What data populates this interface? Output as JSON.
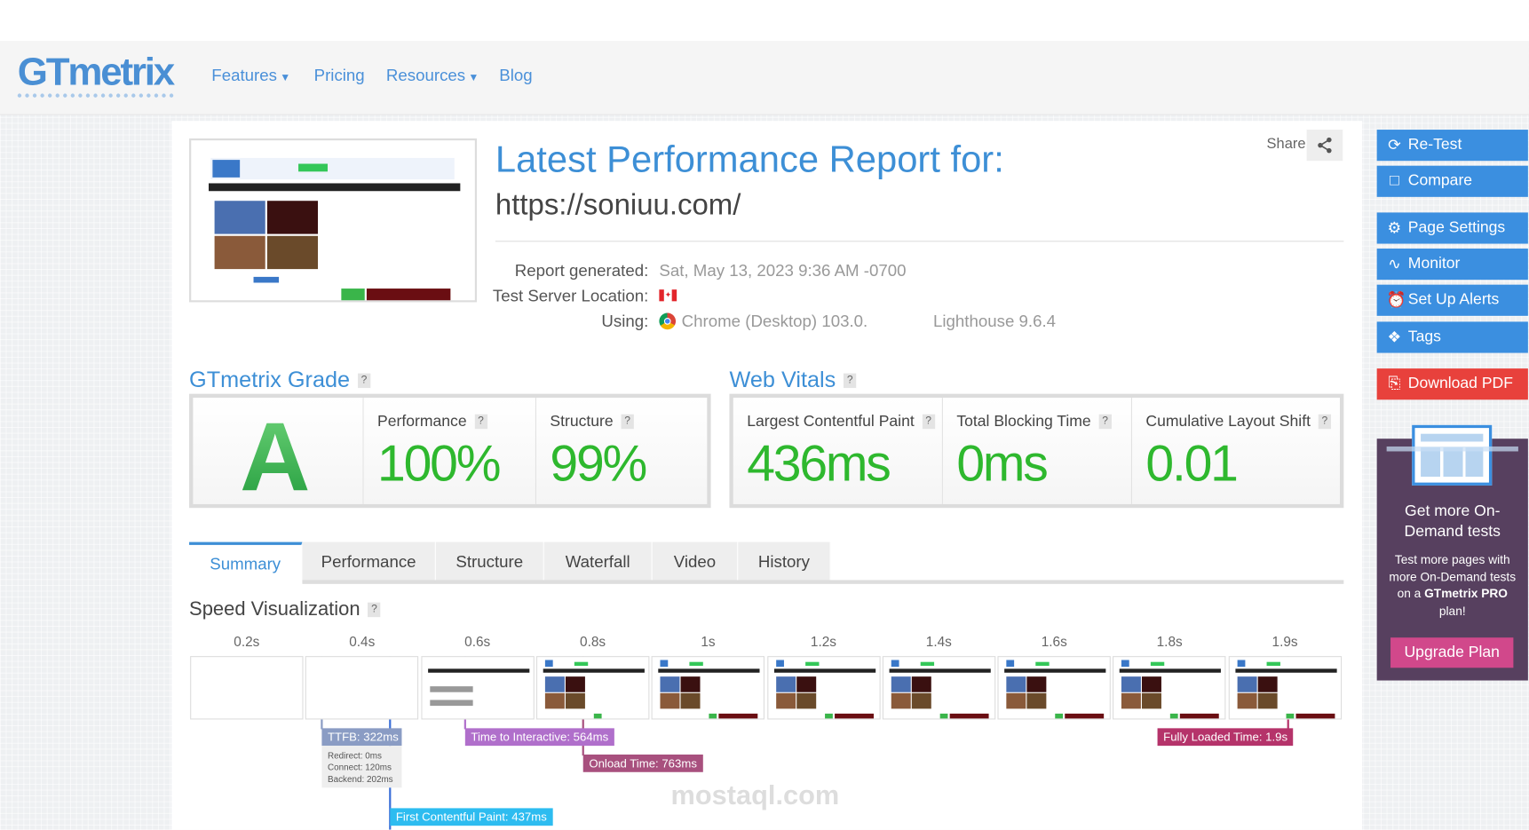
{
  "header": {
    "logo": "GTmetrix",
    "nav": [
      {
        "label": "Features",
        "dropdown": true
      },
      {
        "label": "Pricing",
        "dropdown": false
      },
      {
        "label": "Resources",
        "dropdown": true
      },
      {
        "label": "Blog",
        "dropdown": false
      }
    ]
  },
  "report": {
    "title": "Latest Performance Report for:",
    "url": "https://soniuu.com/",
    "share_label": "Share",
    "info": [
      {
        "label": "Report generated:",
        "value": "Sat, May 13, 2023 9:36 AM -0700"
      },
      {
        "label": "Test Server Location:",
        "value": ""
      },
      {
        "label": "Using:",
        "value": "Chrome (Desktop) 103.0.",
        "extra": "Lighthouse 9.6.4"
      }
    ]
  },
  "grade": {
    "heading": "GTmetrix Grade",
    "letter": "A",
    "metrics": [
      {
        "label": "Performance",
        "value": "100%"
      },
      {
        "label": "Structure",
        "value": "99%"
      }
    ]
  },
  "vitals": {
    "heading": "Web Vitals",
    "metrics": [
      {
        "label": "Largest Contentful Paint",
        "value": "436ms"
      },
      {
        "label": "Total Blocking Time",
        "value": "0ms"
      },
      {
        "label": "Cumulative Layout Shift",
        "value": "0.01"
      }
    ]
  },
  "tabs": [
    {
      "label": "Summary",
      "active": true
    },
    {
      "label": "Performance"
    },
    {
      "label": "Structure"
    },
    {
      "label": "Waterfall"
    },
    {
      "label": "Video"
    },
    {
      "label": "History"
    }
  ],
  "speed": {
    "heading": "Speed Visualization",
    "ticks": [
      "0.2s",
      "0.4s",
      "0.6s",
      "0.8s",
      "1s",
      "1.2s",
      "1.4s",
      "1.6s",
      "1.8s",
      "1.9s"
    ],
    "markers": {
      "ttfb": "TTFB: 322ms",
      "ttfb_details": [
        "Redirect: 0ms",
        "Connect: 120ms",
        "Backend: 202ms"
      ],
      "tti": "Time to Interactive: 564ms",
      "onload": "Onload Time: 763ms",
      "fcp": "First Contentful Paint: 437ms",
      "fully": "Fully Loaded Time: 1.9s"
    }
  },
  "sidebar": {
    "buttons": [
      {
        "label": "Re-Test",
        "icon": "refresh-icon"
      },
      {
        "label": "Compare",
        "icon": "compare-icon"
      },
      {
        "label": "Page Settings",
        "icon": "gear-icon"
      },
      {
        "label": "Monitor",
        "icon": "pulse-icon"
      },
      {
        "label": "Set Up Alerts",
        "icon": "alarm-icon"
      },
      {
        "label": "Tags",
        "icon": "tag-icon"
      },
      {
        "label": "Download PDF",
        "icon": "pdf-icon"
      }
    ],
    "promo": {
      "heading": "Get more On-Demand tests",
      "text_before": "Test more pages with more On-Demand tests on a ",
      "brand": "GTmetrix PRO",
      "text_after": " plan!",
      "button": "Upgrade Plan"
    }
  },
  "watermark": "mostaql.com",
  "colors": {
    "accent": "#3d8fd6",
    "good": "#2eb82e",
    "pdf": "#e8413c",
    "promo": "#57405f"
  }
}
